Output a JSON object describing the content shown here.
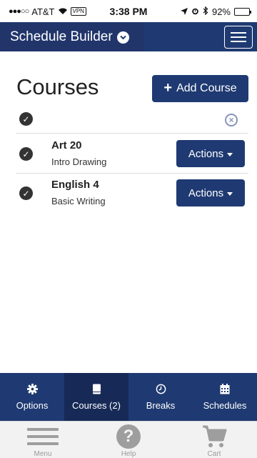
{
  "status_bar": {
    "signal_dots": "●●●○○",
    "carrier": "AT&T",
    "vpn": "VPN",
    "time": "3:38 PM",
    "battery": "92%",
    "battery_level": 0.92
  },
  "header": {
    "title": "Schedule Builder"
  },
  "main": {
    "title": "Courses",
    "add_button_label": "Add Course",
    "courses": [
      {
        "name": "Art 20",
        "description": "Intro Drawing",
        "actions_label": "Actions"
      },
      {
        "name": "English 4",
        "description": "Basic Writing",
        "actions_label": "Actions"
      }
    ]
  },
  "tabs": [
    {
      "label": "Options",
      "icon": "gear-icon",
      "active": false
    },
    {
      "label": "Courses (2)",
      "icon": "book-icon",
      "active": true
    },
    {
      "label": "Breaks",
      "icon": "clock-icon",
      "active": false
    },
    {
      "label": "Schedules",
      "icon": "calendar-icon",
      "active": false
    }
  ],
  "toolbar": [
    {
      "label": "Menu",
      "icon": "menu-icon"
    },
    {
      "label": "Help",
      "icon": "help-icon"
    },
    {
      "label": "Cart",
      "icon": "cart-icon"
    }
  ],
  "colors": {
    "brand": "#1f3a72",
    "active_tab": "#172a57",
    "toolbar_icon": "#9e9e9e"
  }
}
